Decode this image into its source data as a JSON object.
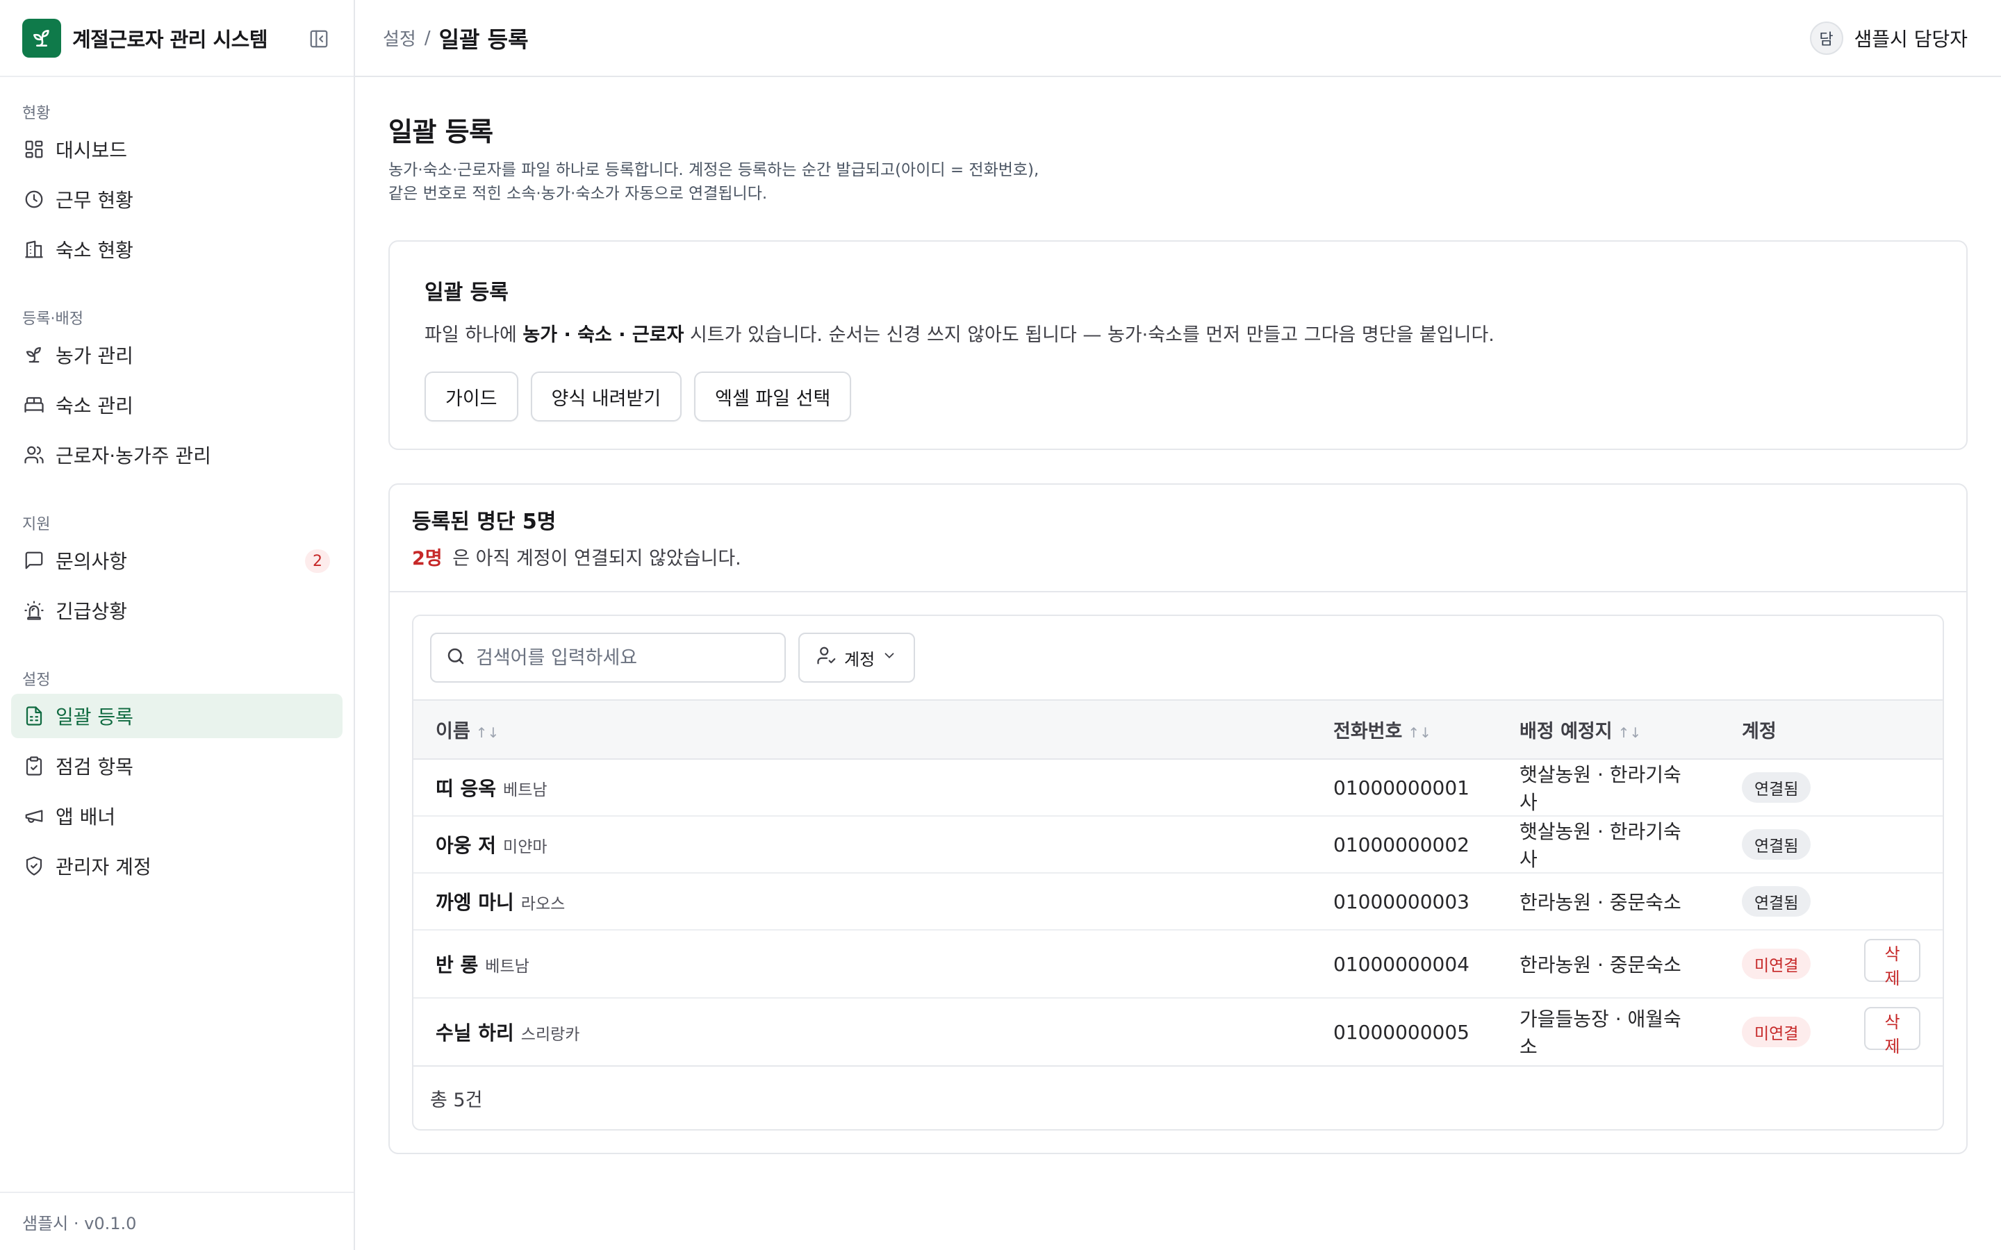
{
  "app": {
    "title": "계절근로자 관리 시스템",
    "version": "샘플시 · v0.1.0"
  },
  "sidebar": {
    "groups": [
      {
        "label": "현황",
        "items": [
          {
            "label": "대시보드",
            "icon": "dashboard-icon"
          },
          {
            "label": "근무 현황",
            "icon": "clock-icon"
          },
          {
            "label": "숙소 현황",
            "icon": "building-icon"
          }
        ]
      },
      {
        "label": "등록·배정",
        "items": [
          {
            "label": "농가 관리",
            "icon": "sprout-icon"
          },
          {
            "label": "숙소 관리",
            "icon": "bed-icon"
          },
          {
            "label": "근로자·농가주 관리",
            "icon": "users-icon"
          }
        ]
      },
      {
        "label": "지원",
        "items": [
          {
            "label": "문의사항",
            "icon": "message-icon",
            "badge": "2"
          },
          {
            "label": "긴급상황",
            "icon": "siren-icon"
          }
        ]
      },
      {
        "label": "설정",
        "items": [
          {
            "label": "일괄 등록",
            "icon": "sheet-icon",
            "active": true
          },
          {
            "label": "점검 항목",
            "icon": "clipboard-check-icon"
          },
          {
            "label": "앱 배너",
            "icon": "megaphone-icon"
          },
          {
            "label": "관리자 계정",
            "icon": "shield-check-icon"
          }
        ]
      }
    ]
  },
  "header": {
    "breadcrumb_parent": "설정",
    "breadcrumb_sep": "/",
    "breadcrumb_current": "일괄 등록",
    "user_initial": "담",
    "user_name": "샘플시 담당자"
  },
  "page": {
    "title": "일괄 등록",
    "description": "농가·숙소·근로자를 파일 하나로 등록합니다. 계정은 등록하는 순간 발급되고(아이디 = 전화번호), 같은 번호로 적힌 소속·농가·숙소가 자동으로 연결됩니다."
  },
  "upload": {
    "title": "일괄 등록",
    "desc_prefix": "파일 하나에 ",
    "desc_bold": "농가 · 숙소 · 근로자",
    "desc_suffix": " 시트가 있습니다. 순서는 신경 쓰지 않아도 됩니다 — 농가·숙소를 먼저 만들고 그다음 명단을 붙입니다.",
    "guide_label": "가이드",
    "template_label": "양식 내려받기",
    "file_label": "엑셀 파일 선택"
  },
  "list": {
    "title": "등록된 명단 5명",
    "warn_count": "2명",
    "warn_text": "은 아직 계정이 연결되지 않았습니다.",
    "search_placeholder": "검색어를 입력하세요",
    "filter_label": "계정",
    "columns": {
      "name": "이름",
      "phone": "전화번호",
      "place": "배정 예정지",
      "account": "계정"
    },
    "sort_glyph": "↑↓",
    "delete_label": "삭제",
    "rows": [
      {
        "name": "띠 응옥",
        "nationality": "베트남",
        "phone": "01000000001",
        "place": "햇살농원 · 한라기숙사",
        "status": "연결됨",
        "linked": true
      },
      {
        "name": "아웅 저",
        "nationality": "미얀마",
        "phone": "01000000002",
        "place": "햇살농원 · 한라기숙사",
        "status": "연결됨",
        "linked": true
      },
      {
        "name": "까엥 마니",
        "nationality": "라오스",
        "phone": "01000000003",
        "place": "한라농원 · 중문숙소",
        "status": "연결됨",
        "linked": true
      },
      {
        "name": "반 롱",
        "nationality": "베트남",
        "phone": "01000000004",
        "place": "한라농원 · 중문숙소",
        "status": "미연결",
        "linked": false
      },
      {
        "name": "수닐 하리",
        "nationality": "스리랑카",
        "phone": "01000000005",
        "place": "가을들농장 · 애월숙소",
        "status": "미연결",
        "linked": false
      }
    ],
    "total": "총 5건"
  },
  "colors": {
    "brand": "#0f7a4a",
    "active_bg": "#e9f3ed",
    "danger": "#c62828"
  }
}
